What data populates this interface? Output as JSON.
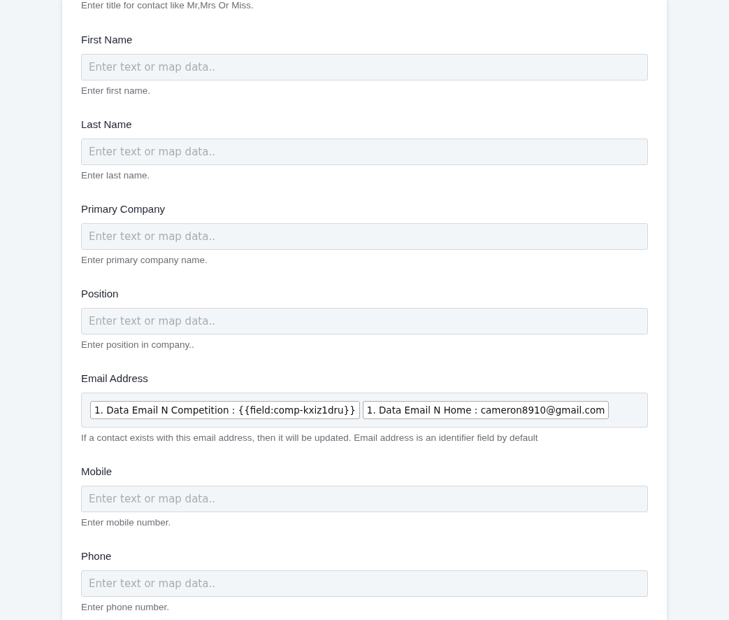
{
  "top_hint": "Enter title for contact like Mr,Mrs Or Miss.",
  "fields": [
    {
      "kind": "text",
      "label": "First Name",
      "placeholder": "Enter text or map data..",
      "hint": "Enter first name."
    },
    {
      "kind": "text",
      "label": "Last Name",
      "placeholder": "Enter text or map data..",
      "hint": "Enter last name."
    },
    {
      "kind": "text",
      "label": "Primary Company",
      "placeholder": "Enter text or map data..",
      "hint": "Enter primary company name."
    },
    {
      "kind": "text",
      "label": "Position",
      "placeholder": "Enter text or map data..",
      "hint": "Enter position in company.."
    },
    {
      "kind": "tags",
      "label": "Email Address",
      "tags": [
        "1. Data Email N Competition : {{field:comp-kxiz1dru}}",
        "1. Data Email N Home : cameron8910@gmail.com"
      ],
      "hint": "If a contact exists with this email address, then it will be updated. Email address is an identifier field by default"
    },
    {
      "kind": "text",
      "label": "Mobile",
      "placeholder": "Enter text or map data..",
      "hint": "Enter mobile number."
    },
    {
      "kind": "text",
      "label": "Phone",
      "placeholder": "Enter text or map data..",
      "hint": "Enter phone number."
    }
  ]
}
